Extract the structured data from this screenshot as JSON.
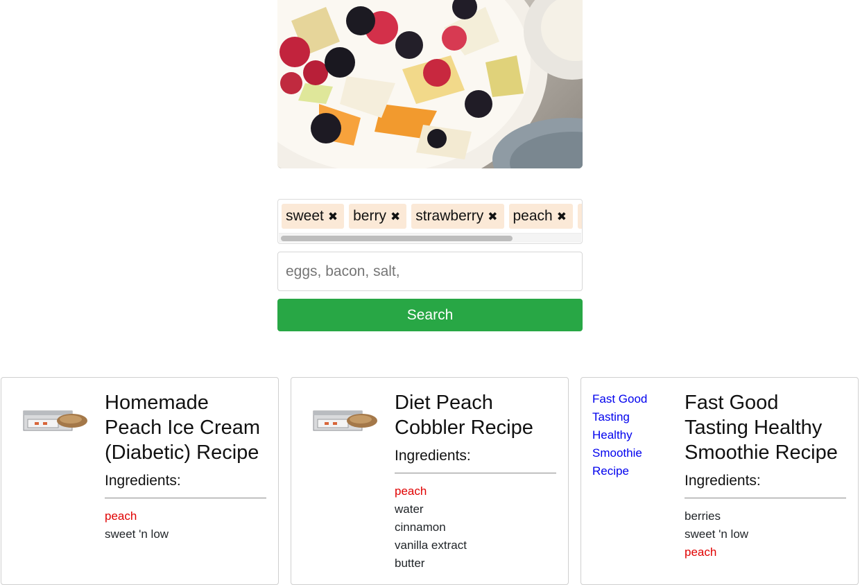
{
  "hero": {
    "description_icon": "fruit-bowl-photo"
  },
  "tags": [
    {
      "label": "sweet",
      "remove": "✖"
    },
    {
      "label": "berry",
      "remove": "✖"
    },
    {
      "label": "strawberry",
      "remove": "✖"
    },
    {
      "label": "peach",
      "remove": "✖"
    }
  ],
  "search": {
    "placeholder": "eggs, bacon, salt,",
    "button_label": "Search"
  },
  "colors": {
    "search_button": "#28a745",
    "tag_background": "#fbe9d7",
    "matched_ingredient": "#e00000",
    "link": "#0000ee"
  },
  "cards": [
    {
      "title": "Homemade Peach Ice Cream (Diabetic) Recipe",
      "ingredients_heading": "Ingredients:",
      "ingredients": [
        {
          "name": "peach",
          "matched": true
        },
        {
          "name": "sweet 'n low",
          "matched": false
        }
      ]
    },
    {
      "title": "Diet Peach Cobbler Recipe",
      "ingredients_heading": "Ingredients:",
      "ingredients": [
        {
          "name": "peach",
          "matched": true
        },
        {
          "name": "water",
          "matched": false
        },
        {
          "name": "cinnamon",
          "matched": false
        },
        {
          "name": "vanilla extract",
          "matched": false
        },
        {
          "name": "butter",
          "matched": false
        }
      ]
    },
    {
      "title": "Fast Good Tasting Healthy Smoothie Recipe",
      "image_alt": "Fast Good Tasting Healthy Smoothie Recipe",
      "ingredients_heading": "Ingredients:",
      "ingredients": [
        {
          "name": "berries",
          "matched": false
        },
        {
          "name": "sweet 'n low",
          "matched": false
        },
        {
          "name": "peach",
          "matched": true
        }
      ]
    }
  ]
}
